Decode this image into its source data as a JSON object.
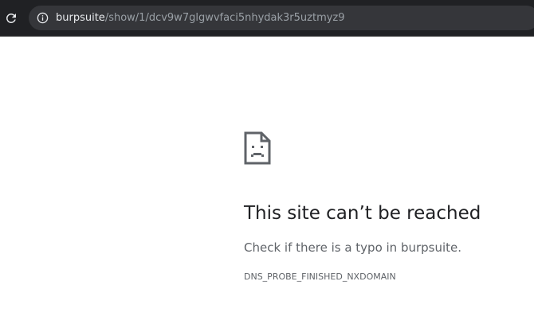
{
  "address_bar": {
    "host": "burpsuite",
    "path": "/show/1/dcv9w7glgwvfaci5nhydak3r5uztmyz9"
  },
  "error_page": {
    "icon": "sad-document-icon",
    "heading": "This site can’t be reached",
    "message": "Check if there is a typo in burpsuite.",
    "error_code": "DNS_PROBE_FINISHED_NXDOMAIN"
  },
  "colors": {
    "toolbar_bg": "#202124",
    "omnibox_bg": "#35363a",
    "heading_text": "#202124",
    "secondary_text": "#5f6368"
  }
}
